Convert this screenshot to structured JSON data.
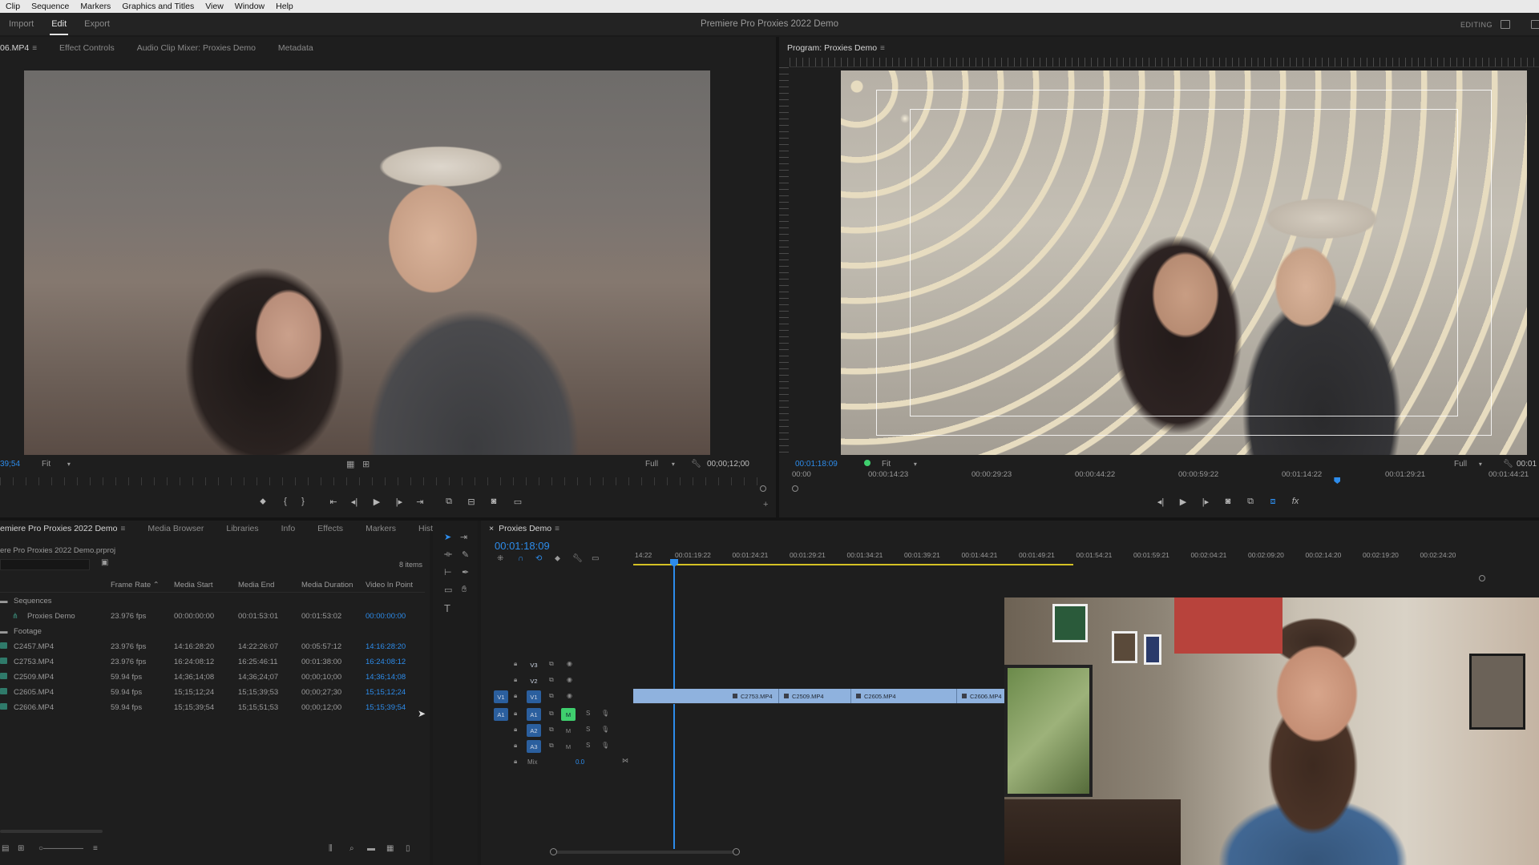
{
  "menu": [
    "Clip",
    "Sequence",
    "Markers",
    "Graphics and Titles",
    "View",
    "Window",
    "Help"
  ],
  "workspace": {
    "tabs": [
      "Import",
      "Edit",
      "Export"
    ],
    "active": "Edit",
    "mode": "EDITING"
  },
  "app_title": "Premiere Pro Proxies 2022 Demo",
  "source_panel": {
    "tabs": [
      "06.MP4",
      "Effect Controls",
      "Audio Clip Mixer: Proxies Demo",
      "Metadata"
    ],
    "timecode_left": "39;54",
    "zoom": "Fit",
    "resolution": "Full",
    "duration": "00;00;12;00"
  },
  "program_panel": {
    "title": "Program: Proxies Demo",
    "timecode": "00:01:18:09",
    "zoom": "Fit",
    "resolution": "Full",
    "timecode_right": "00:01",
    "ruler": [
      "00:00",
      "00:00:14:23",
      "00:00:29:23",
      "00:00:44:22",
      "00:00:59:22",
      "00:01:14:22",
      "00:01:29:21",
      "00:01:44:21"
    ],
    "playhead_fraction": 0.73
  },
  "project_panel": {
    "tabs": [
      "emiere Pro Proxies 2022 Demo",
      "Media Browser",
      "Libraries",
      "Info",
      "Effects",
      "Markers",
      "Hist"
    ],
    "path": "ere Pro Proxies 2022 Demo.prproj",
    "item_count": "8 items",
    "columns": [
      "Frame Rate",
      "Media Start",
      "Media End",
      "Media Duration",
      "Video In Point"
    ],
    "bins": {
      "sequences": "Sequences",
      "footage": "Footage"
    },
    "sequence_rows": [
      {
        "name": "Proxies Demo",
        "frame_rate": "23.976 fps",
        "start": "00:00:00:00",
        "end": "00:01:53:01",
        "duration": "00:01:53:02",
        "in_point": "00:00:00:00"
      }
    ],
    "footage_rows": [
      {
        "name": "C2457.MP4",
        "frame_rate": "23.976 fps",
        "start": "14:16:28:20",
        "end": "14:22:26:07",
        "duration": "00:05:57:12",
        "in_point": "14:16:28:20"
      },
      {
        "name": "C2753.MP4",
        "frame_rate": "23.976 fps",
        "start": "16:24:08:12",
        "end": "16:25:46:11",
        "duration": "00:01:38:00",
        "in_point": "16:24:08:12"
      },
      {
        "name": "C2509.MP4",
        "frame_rate": "59.94 fps",
        "start": "14;36;14;08",
        "end": "14;36;24;07",
        "duration": "00;00;10;00",
        "in_point": "14;36;14;08"
      },
      {
        "name": "C2605.MP4",
        "frame_rate": "59.94 fps",
        "start": "15;15;12;24",
        "end": "15;15;39;53",
        "duration": "00;00;27;30",
        "in_point": "15;15;12;24"
      },
      {
        "name": "C2606.MP4",
        "frame_rate": "59.94 fps",
        "start": "15;15;39;54",
        "end": "15;15;51;53",
        "duration": "00;00;12;00",
        "in_point": "15;15;39;54"
      }
    ]
  },
  "timeline": {
    "title": "Proxies Demo",
    "timecode": "00:01:18:09",
    "ruler": [
      "14:22",
      "00:01:19:22",
      "00:01:24:21",
      "00:01:29:21",
      "00:01:34:21",
      "00:01:39:21",
      "00:01:44:21",
      "00:01:49:21",
      "00:01:54:21",
      "00:01:59:21",
      "00:02:04:21",
      "00:02:09:20",
      "00:02:14:20",
      "00:02:19:20",
      "00:02:24:20"
    ],
    "video_tracks": [
      "V3",
      "V2",
      "V1"
    ],
    "audio_tracks": [
      "A1",
      "A2",
      "A3"
    ],
    "source_patch_video": "V1",
    "source_patch_audio": "A1",
    "mix_label": "Mix",
    "mix_value": "0.0",
    "mute_label": "M",
    "solo_label": "S",
    "clips": [
      "C2753.MP4",
      "C2509.MP4",
      "C2605.MP4",
      "C2606.MP4"
    ]
  },
  "colors": {
    "accent": "#2d8ceb",
    "clip": "#8fb2de",
    "work_area": "#d4c024",
    "mute_on": "#3fcf6e"
  }
}
